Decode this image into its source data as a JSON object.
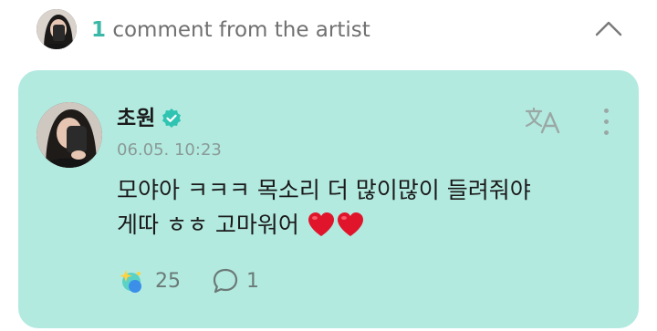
{
  "header": {
    "count": "1",
    "label": "comment from the artist"
  },
  "comment": {
    "author": "초원",
    "timestamp": "06.05. 10:23",
    "body_lines": [
      "모야아 ㅋㅋㅋ 목소리 더 많이많이 들려줘야",
      "게따 ㅎㅎ 고마워어"
    ],
    "like_count": "25",
    "reply_count": "1"
  },
  "icons": {
    "verified": "verified-badge-icon",
    "translate": "translate-icon",
    "more": "more-vertical-icon",
    "collapse": "chevron-up-icon",
    "like": "sparkle-like-icon",
    "reply": "speech-bubble-icon",
    "heart": "red-heart-emoji"
  },
  "colors": {
    "accent": "#3cb8a8",
    "card_background": "#b3eae0",
    "heart": "#e0142a",
    "verified": "#2fc4b2"
  }
}
